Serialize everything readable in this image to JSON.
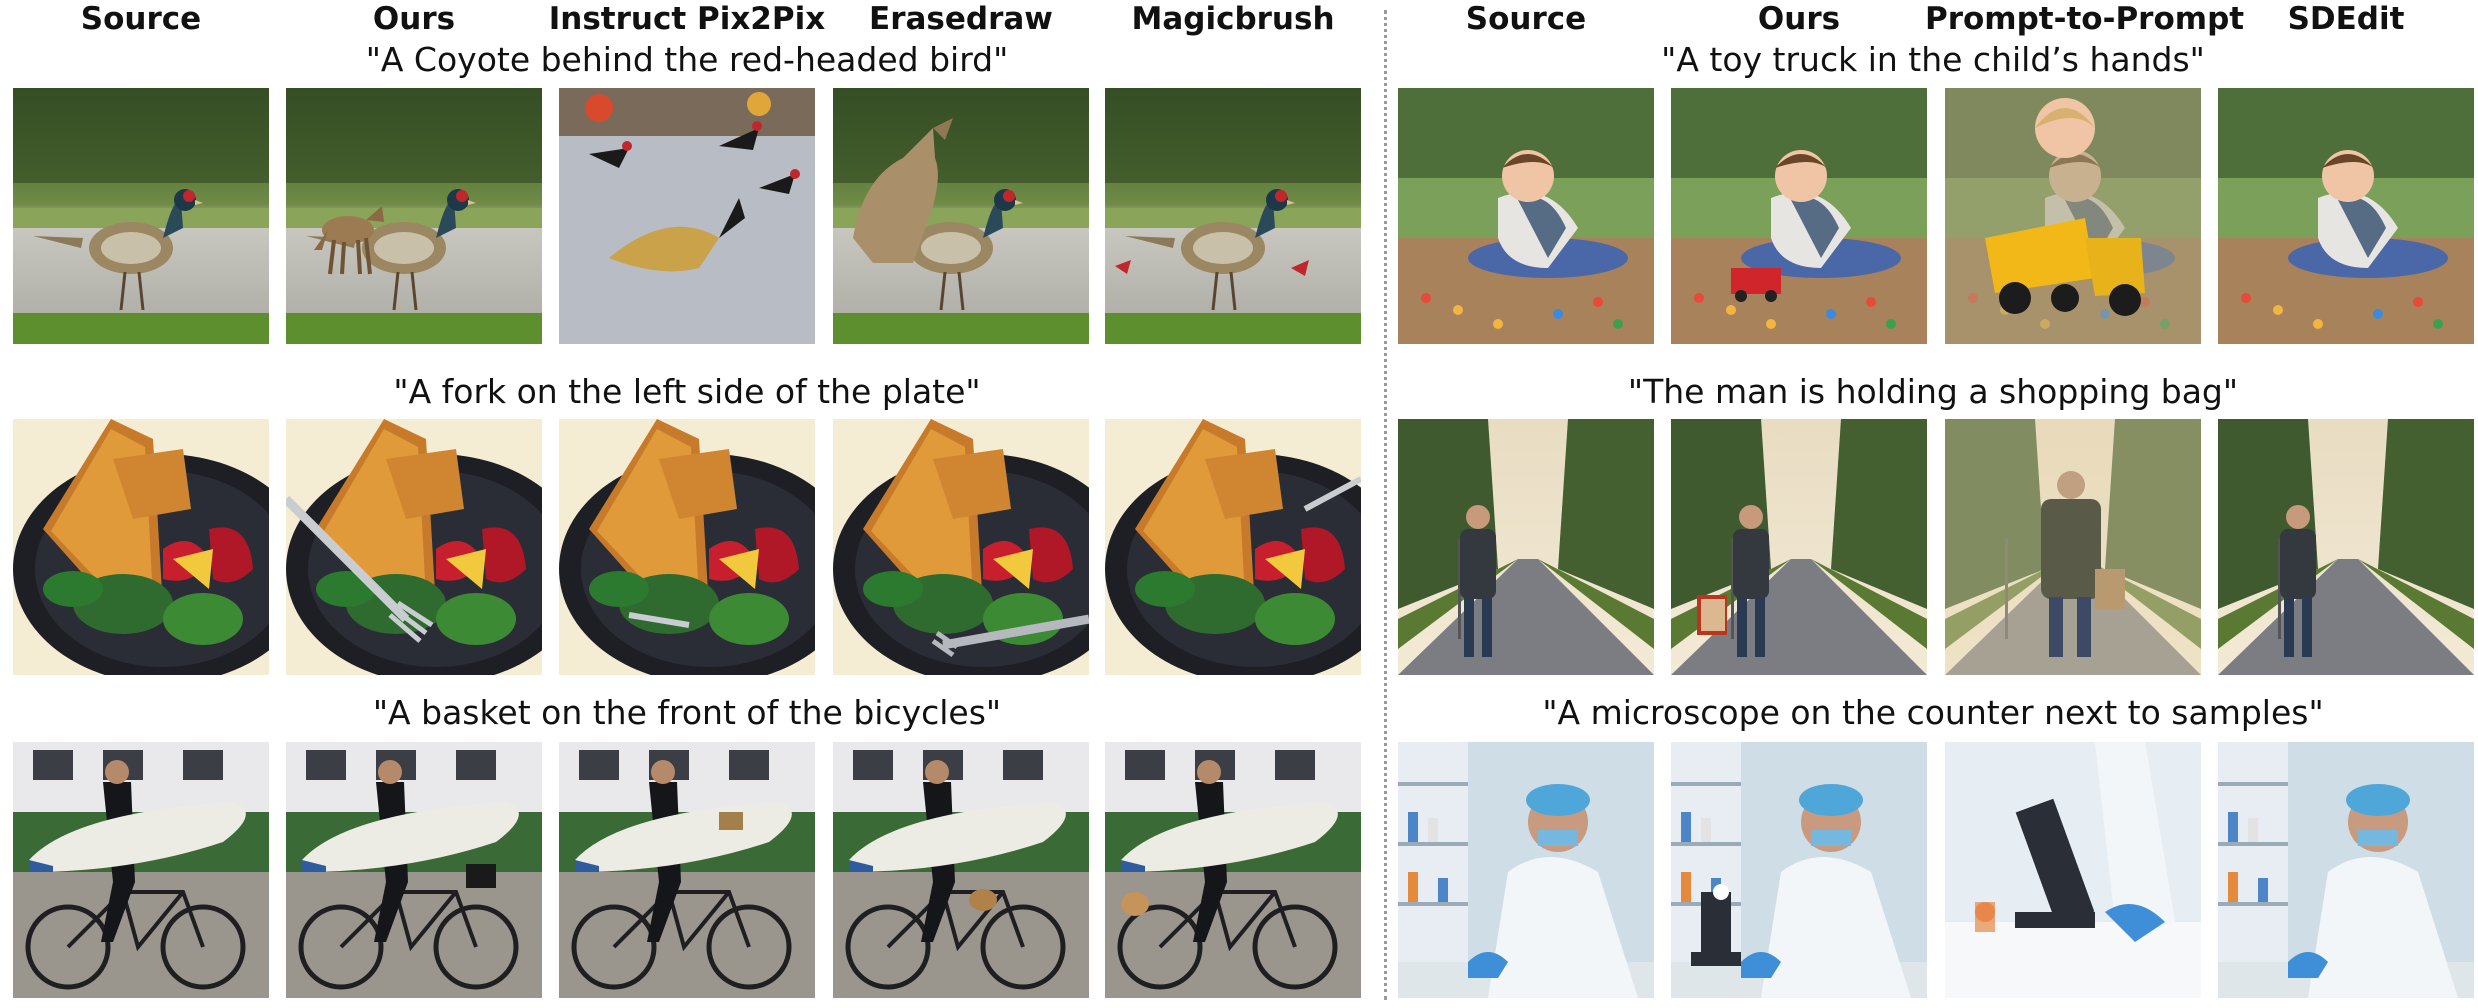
{
  "left_panel": {
    "headers": [
      "Source",
      "Ours",
      "Instruct Pix2Pix",
      "Erasedraw",
      "Magicbrush"
    ],
    "rows": [
      {
        "prompt": "\"A Coyote behind the red-headed bird\"",
        "scene": "pheasant",
        "variants": [
          "source",
          "ours-coyote",
          "pix2pix",
          "erasedraw",
          "magicbrush"
        ]
      },
      {
        "prompt": "\"A fork on the left side of the plate\"",
        "scene": "plate",
        "variants": [
          "source",
          "fork-left",
          "fork-left-small",
          "fork-front",
          "fork-right"
        ]
      },
      {
        "prompt": "\"A basket on the front of the bicycles\"",
        "scene": "bicycle",
        "variants": [
          "source",
          "basket-black",
          "basket-none",
          "basket-rear",
          "basket-left"
        ]
      }
    ]
  },
  "right_panel": {
    "headers": [
      "Source",
      "Ours",
      "Prompt-to-Prompt",
      "SDEdit"
    ],
    "rows": [
      {
        "prompt": "\"A toy truck in the child’s hands\"",
        "scene": "child",
        "variants": [
          "source",
          "small-truck",
          "big-truck",
          "source-alt"
        ]
      },
      {
        "prompt": "\"The man is holding a shopping bag\"",
        "scene": "road",
        "variants": [
          "source",
          "bag-red",
          "bag-paper",
          "source-alt"
        ]
      },
      {
        "prompt": "\"A microscope on the counter next to samples\"",
        "scene": "lab",
        "variants": [
          "source",
          "microscope",
          "microscope-big",
          "source-alt"
        ]
      }
    ]
  }
}
